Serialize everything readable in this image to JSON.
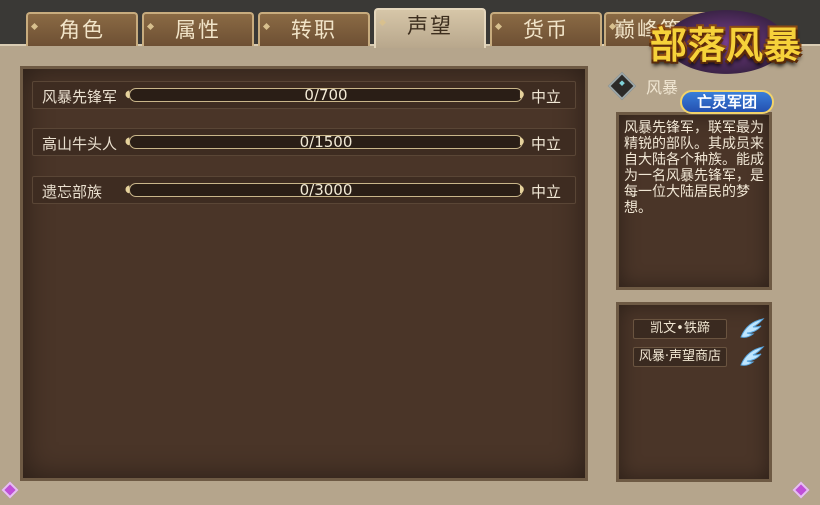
{
  "tabs": [
    {
      "label": "角色",
      "active": false
    },
    {
      "label": "属性",
      "active": false
    },
    {
      "label": "转职",
      "active": false
    },
    {
      "label": "声望",
      "active": true
    },
    {
      "label": "货币",
      "active": false
    },
    {
      "label": "巅峰等",
      "active": false
    }
  ],
  "reputations": [
    {
      "name": "风暴先锋军",
      "value": "0/700",
      "progress": 0,
      "status": "中立"
    },
    {
      "name": "高山牛头人",
      "value": "0/1500",
      "progress": 0,
      "status": "中立"
    },
    {
      "name": "遗忘部族",
      "value": "0/3000",
      "progress": 0,
      "status": "中立"
    }
  ],
  "detail": {
    "title": "风暴",
    "description": "风暴先锋军，联军最为精锐的部队。其成员来自大陆各个种族。能成为一名风暴先锋军，是每一位大陆居民的梦想。"
  },
  "links": [
    {
      "label": "凯文•铁蹄"
    },
    {
      "label": "风暴·声望商店"
    }
  ],
  "logo": {
    "title": "部落风暴",
    "subtitle": "亡灵军团"
  },
  "colors": {
    "panel": "#4a3528",
    "frame": "#b5a58c",
    "logo_gold": "#f6d23a"
  }
}
